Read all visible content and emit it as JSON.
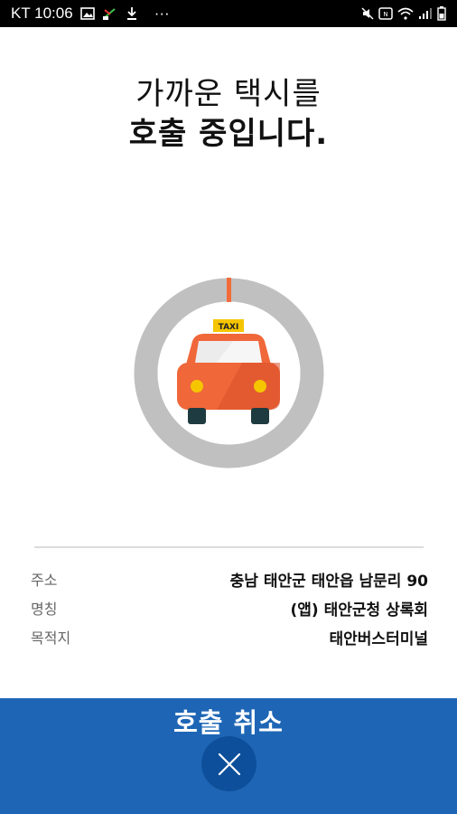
{
  "status_bar": {
    "carrier_time": "KT 10:06",
    "more": "···",
    "icons_left": [
      "image-icon",
      "missed-call-icon",
      "download-icon"
    ],
    "icons_right": [
      "mute-icon",
      "nfc-icon",
      "wifi-icon",
      "signal-icon",
      "battery-icon"
    ]
  },
  "headline": {
    "line1": "가까운 택시를",
    "line2": "호출 중입니다."
  },
  "taxi": {
    "sign": "TAXI",
    "ring_color": "#c0c0c0",
    "progress_color": "#f26b3a",
    "car_color": "#f0673a"
  },
  "info": {
    "rows": [
      {
        "label": "주소",
        "value": "충남 태안군 태안읍 남문리 90"
      },
      {
        "label": "명칭",
        "value": "(앱) 태안군청 상록회"
      },
      {
        "label": "목적지",
        "value": "태안버스터미널"
      }
    ]
  },
  "cancel": {
    "title": "호출 취소",
    "panel_color": "#1e66b5",
    "button_color": "#0d4f9a"
  }
}
